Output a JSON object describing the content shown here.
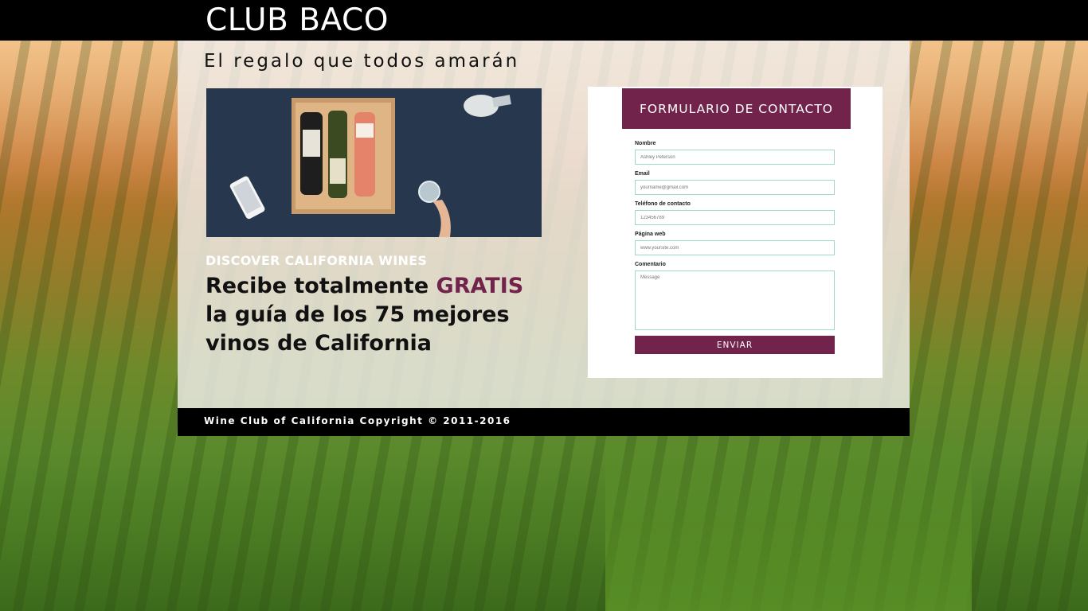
{
  "header": {
    "brand": "CLUB BACO"
  },
  "hero": {
    "tagline": "El regalo que todos amarán",
    "image_icon": "wine-box-photo",
    "discover": "DISCOVER CALIFORNIA WINES",
    "headline_part1": "Recibe totalmente ",
    "headline_accent": "GRATIS",
    "headline_part2": "la guía de los 75 mejores vinos de California"
  },
  "form": {
    "title": "FORMULARIO DE CONTACTO",
    "fields": [
      {
        "label": "Nombre",
        "placeholder": "Ashley Peterson"
      },
      {
        "label": "Email",
        "placeholder": "yourname@gmail.com"
      },
      {
        "label": "Teléfono de contacto",
        "placeholder": "123456789"
      },
      {
        "label": "Página web",
        "placeholder": "www.yoursite.com"
      },
      {
        "label": "Comentario",
        "placeholder": "Message"
      }
    ],
    "submit_label": "ENVIAR"
  },
  "footer": {
    "text": "Wine Club of California Copyright © 2011-2016"
  },
  "colors": {
    "accent": "#71234b",
    "input_border": "#9fd9c2",
    "bar": "#000000"
  }
}
